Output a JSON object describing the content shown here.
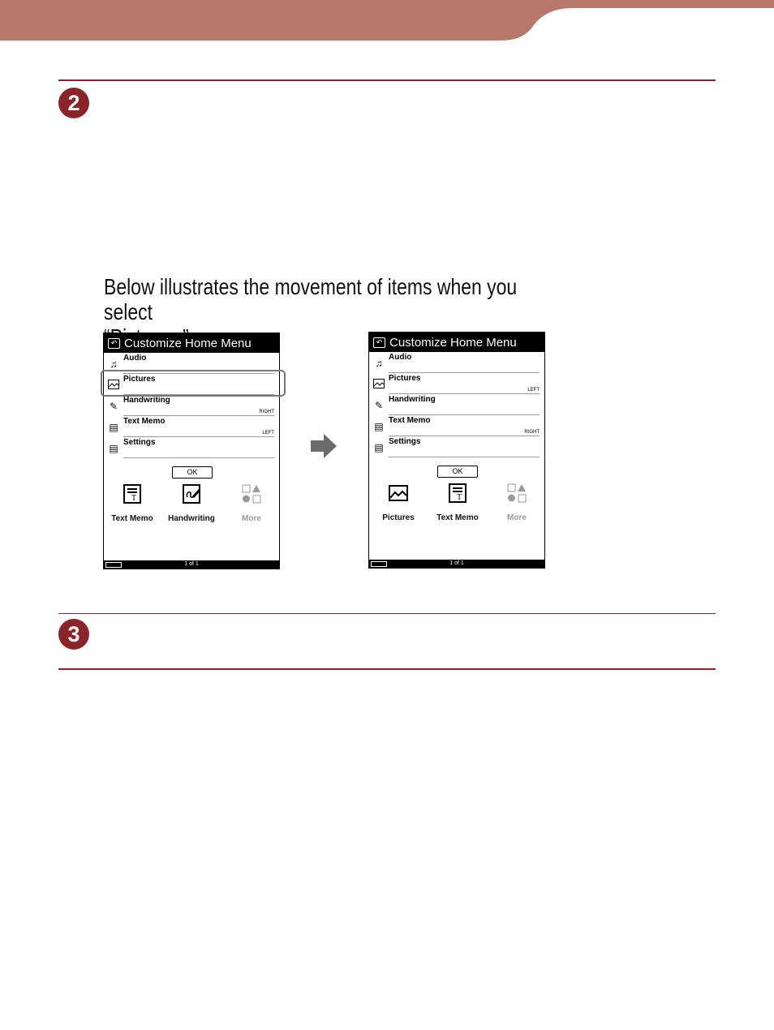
{
  "header": {
    "band_color": "#b8776b"
  },
  "accent_color": "#8b2328",
  "steps": [
    {
      "number": "2"
    },
    {
      "number": "3"
    }
  ],
  "intro_text_line1": "Below illustrates the movement of items when you select",
  "intro_text_line2": "“Pictures.”",
  "screens": [
    {
      "title": "Customize Home Menu",
      "rows": [
        {
          "icon": "music-note-icon",
          "label": "Audio",
          "tag": ""
        },
        {
          "icon": "picture-icon",
          "label": "Pictures",
          "tag": ""
        },
        {
          "icon": "handwriting-icon",
          "label": "Handwriting",
          "tag": "RIGHT"
        },
        {
          "icon": "text-memo-icon",
          "label": "Text Memo",
          "tag": "LEFT"
        },
        {
          "icon": "settings-icon",
          "label": "Settings",
          "tag": ""
        }
      ],
      "ok_label": "OK",
      "home_icons": [
        {
          "icon": "text-memo-icon",
          "label": "Text Memo"
        },
        {
          "icon": "handwriting-icon",
          "label": "Handwriting"
        },
        {
          "icon": "more-icon",
          "label": "More"
        }
      ],
      "page": "1 of 1"
    },
    {
      "title": "Customize Home Menu",
      "rows": [
        {
          "icon": "music-note-icon",
          "label": "Audio",
          "tag": ""
        },
        {
          "icon": "picture-icon",
          "label": "Pictures",
          "tag": "LEFT"
        },
        {
          "icon": "handwriting-icon",
          "label": "Handwriting",
          "tag": ""
        },
        {
          "icon": "text-memo-icon",
          "label": "Text Memo",
          "tag": "RIGHT"
        },
        {
          "icon": "settings-icon",
          "label": "Settings",
          "tag": ""
        }
      ],
      "ok_label": "OK",
      "home_icons": [
        {
          "icon": "picture-icon",
          "label": "Pictures"
        },
        {
          "icon": "text-memo-icon",
          "label": "Text Memo"
        },
        {
          "icon": "more-icon",
          "label": "More"
        }
      ],
      "page": "1 of 1"
    }
  ]
}
